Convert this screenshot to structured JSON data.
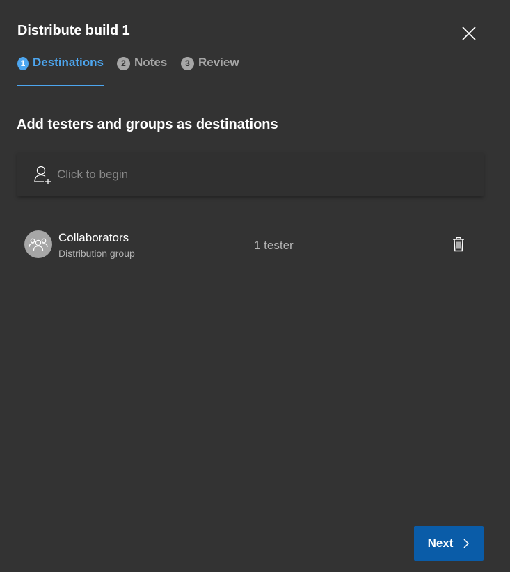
{
  "dialog": {
    "title": "Distribute build 1"
  },
  "steps": [
    {
      "number": "1",
      "label": "Destinations",
      "active": true
    },
    {
      "number": "2",
      "label": "Notes",
      "active": false
    },
    {
      "number": "3",
      "label": "Review",
      "active": false
    }
  ],
  "destinations": {
    "heading": "Add testers and groups as destinations",
    "search": {
      "placeholder": "Click to begin",
      "value": "",
      "icon": "add-person-icon"
    },
    "groups": [
      {
        "name": "Collaborators",
        "type": "Distribution group",
        "count": "1 tester",
        "avatar_icon": "group-icon"
      }
    ]
  },
  "footer": {
    "next_label": "Next"
  },
  "colors": {
    "background": "#333333",
    "accent": "#4da6ef",
    "primary_button": "#0a5ca8",
    "muted_text": "#b3b3b3"
  }
}
